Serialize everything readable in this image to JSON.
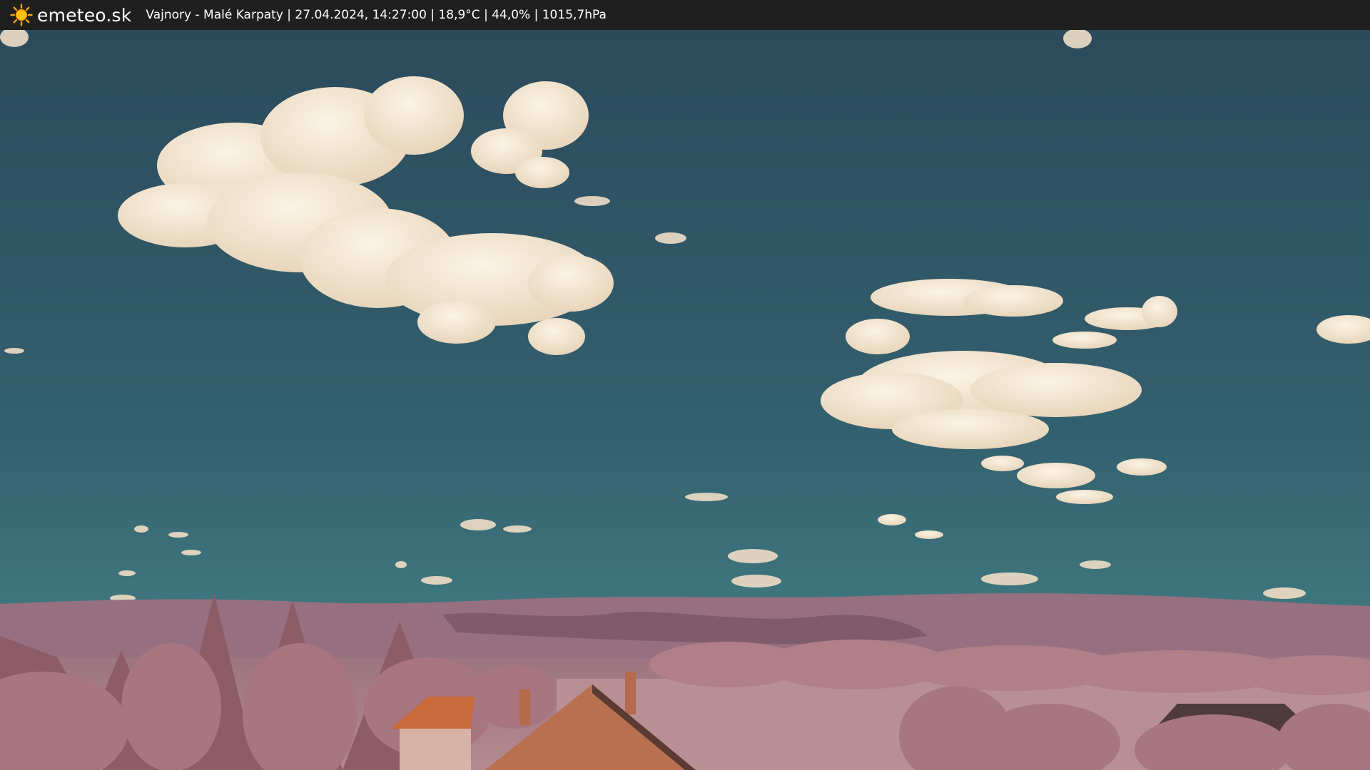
{
  "header": {
    "icon": "sun-icon",
    "brand": "emeteo.sk",
    "station_info": "Vajnory - Malé Karpaty | 27.04.2024, 14:27:00 | 18,9°C | 44,0% | 1015,7hPa"
  },
  "image": {
    "type": "webcam-photo",
    "colors": {
      "sky_top": "#2c4a5c",
      "sky_bottom": "#3f7f86",
      "cloud": "#f3e7d2",
      "hills": "#9a6f7a",
      "foliage": "#b98a8e",
      "field": "#b58c92",
      "roof": "#c2703f"
    }
  }
}
